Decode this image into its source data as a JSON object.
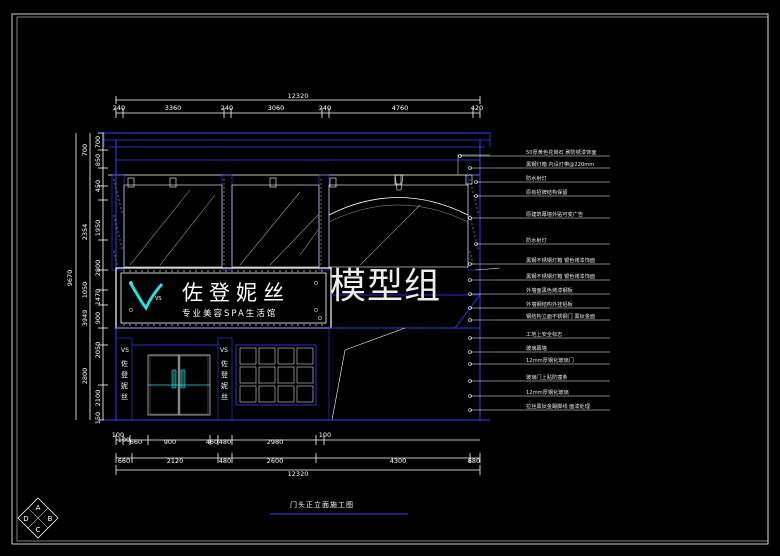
{
  "drawing": {
    "title": "门头正立面施工图",
    "watermark": "模型组",
    "top_total": "12320",
    "bottom_total": "12320",
    "top_dims": [
      "240",
      "3360",
      "240",
      "3060",
      "240",
      "4760",
      "420"
    ],
    "bottom_dims1": [
      "100",
      "100",
      "660",
      "900",
      "460",
      "480",
      "2980",
      "100"
    ],
    "bottom_dims2": [
      "660",
      "2120",
      "480",
      "2600",
      "4300",
      "680"
    ],
    "left_inner": [
      "700",
      "850",
      "450",
      "1950",
      "2800",
      "1470",
      "900",
      "2050",
      "2100",
      "150"
    ],
    "left_outer": [
      "9670",
      "2354",
      "1050",
      "3949"
    ],
    "sign": {
      "name": "佐登妮丝",
      "subtitle": "专业美容SPA生活馆",
      "logo": "VS",
      "vertical": [
        "佐",
        "登",
        "妮",
        "丝"
      ]
    },
    "annotations": [
      "50厚黄色花岗石 刷防锈漆饰面",
      "黑钢灯箱 内设灯带@220mm",
      "防水射灯",
      "原有招牌结构保留",
      "原建筑幕墙外贴可变广告",
      "防水射灯",
      "黑钢不锈钢灯箱 银色烤漆饰面",
      "黑钢不锈钢灯箱 银色烤漆饰面",
      "外墙面黑色烤漆钢板",
      "外墙钢结构外挂铝板",
      "钢结构立面不锈钢门 黑钛金面",
      "工地上安全标志",
      "玻璃幕墙",
      "12mm厚钢化玻璃门",
      "玻璃门上贴防撞条",
      "12mm厚钢化玻璃",
      "拉丝黑钛金踢脚线 面漆处理"
    ],
    "compass": {
      "n": "D",
      "e": "B",
      "s": "C",
      "w": "A"
    }
  }
}
